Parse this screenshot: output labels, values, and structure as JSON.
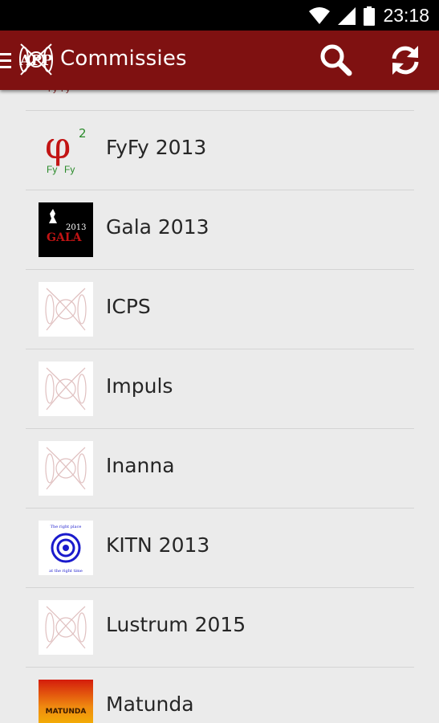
{
  "status_bar": {
    "time": "23:18"
  },
  "app_bar": {
    "title": "Commissies"
  },
  "list": {
    "items": [
      {
        "label": "FyFy 2013",
        "logo": "fyfy-logo"
      },
      {
        "label": "Gala 2013",
        "logo": "gala-logo"
      },
      {
        "label": "ICPS",
        "logo": "app-placeholder-logo"
      },
      {
        "label": "Impuls",
        "logo": "app-placeholder-logo"
      },
      {
        "label": "Inanna",
        "logo": "app-placeholder-logo"
      },
      {
        "label": "KITN 2013",
        "logo": "kitn-logo"
      },
      {
        "label": "Lustrum 2015",
        "logo": "app-placeholder-logo"
      },
      {
        "label": "Matunda",
        "logo": "matunda-logo"
      }
    ]
  },
  "logos": {
    "fyfy": {
      "main": "φ",
      "sup": "2",
      "sub_left": "Fy",
      "sub_right": "Fy"
    },
    "gala": {
      "year": "2013",
      "word": "GALA"
    },
    "kitn": {
      "top": "The right place",
      "bottom": "at the right time"
    },
    "matunda": {
      "word": "MATUNDA"
    }
  },
  "colors": {
    "app_bar": "#7f1111",
    "background": "#ebebeb",
    "divider": "#d4d4d4",
    "text": "#262626"
  }
}
